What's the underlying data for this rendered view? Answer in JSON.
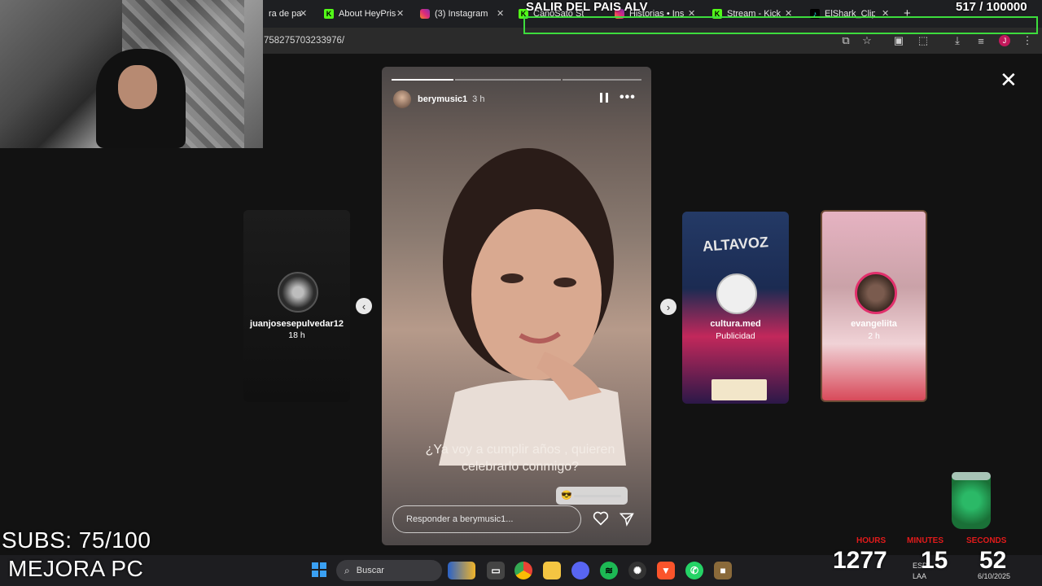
{
  "browser": {
    "tabs": [
      {
        "label": "ra de pa",
        "favicon": "tab-icon"
      },
      {
        "label": "About HeyPris",
        "favicon": "kick-icon"
      },
      {
        "label": "(3) Instagram",
        "favicon": "instagram-icon"
      },
      {
        "label": "CanoSato Str",
        "favicon": "kick-icon"
      },
      {
        "label": "Historias • Ins",
        "favicon": "instagram-icon"
      },
      {
        "label": "Stream - Kick",
        "favicon": "kick-icon"
      },
      {
        "label": "ElShark_Clips",
        "favicon": "tiktok-icon"
      }
    ],
    "url": "758275703233976/"
  },
  "viewer": {
    "left_story": {
      "username": "juanjosesepulvedar12",
      "time": "18 h"
    },
    "current_story": {
      "username": "berymusic1",
      "time": "3 h",
      "progress_segments": [
        1.0,
        0.0,
        0.0
      ],
      "caption_line1": "¿Ya voy a cumplir años , quieren",
      "caption_line2": "celebrarlo conmigo?",
      "slider_emoji": "😎",
      "reply_placeholder": "Responder a berymusic1..."
    },
    "right_stories": [
      {
        "username": "cultura.med",
        "subtitle": "Publicidad",
        "poster_text": "ALTAVOZ"
      },
      {
        "username": "evangeliita",
        "time": "2 h"
      }
    ]
  },
  "overlay": {
    "title": "SALIR DEL PAIS ALV",
    "goal_count": "517",
    "goal_total": "/ 100000",
    "subs": "SUBS: 75/100",
    "banner": "MEJORA PC",
    "timer": {
      "hours_label": "HOURS",
      "minutes_label": "MINUTES",
      "seconds_label": "SECONDS",
      "hours": "1277",
      "minutes": "15",
      "seconds": "52"
    }
  },
  "taskbar": {
    "search_label": "Buscar",
    "lang": "ESP",
    "lang2": "LAA",
    "date": "6/10/2025"
  },
  "colors": {
    "accent_green": "#3ddc3d",
    "timer_red": "#e21b1b",
    "instagram_pink": "#e1306c"
  }
}
